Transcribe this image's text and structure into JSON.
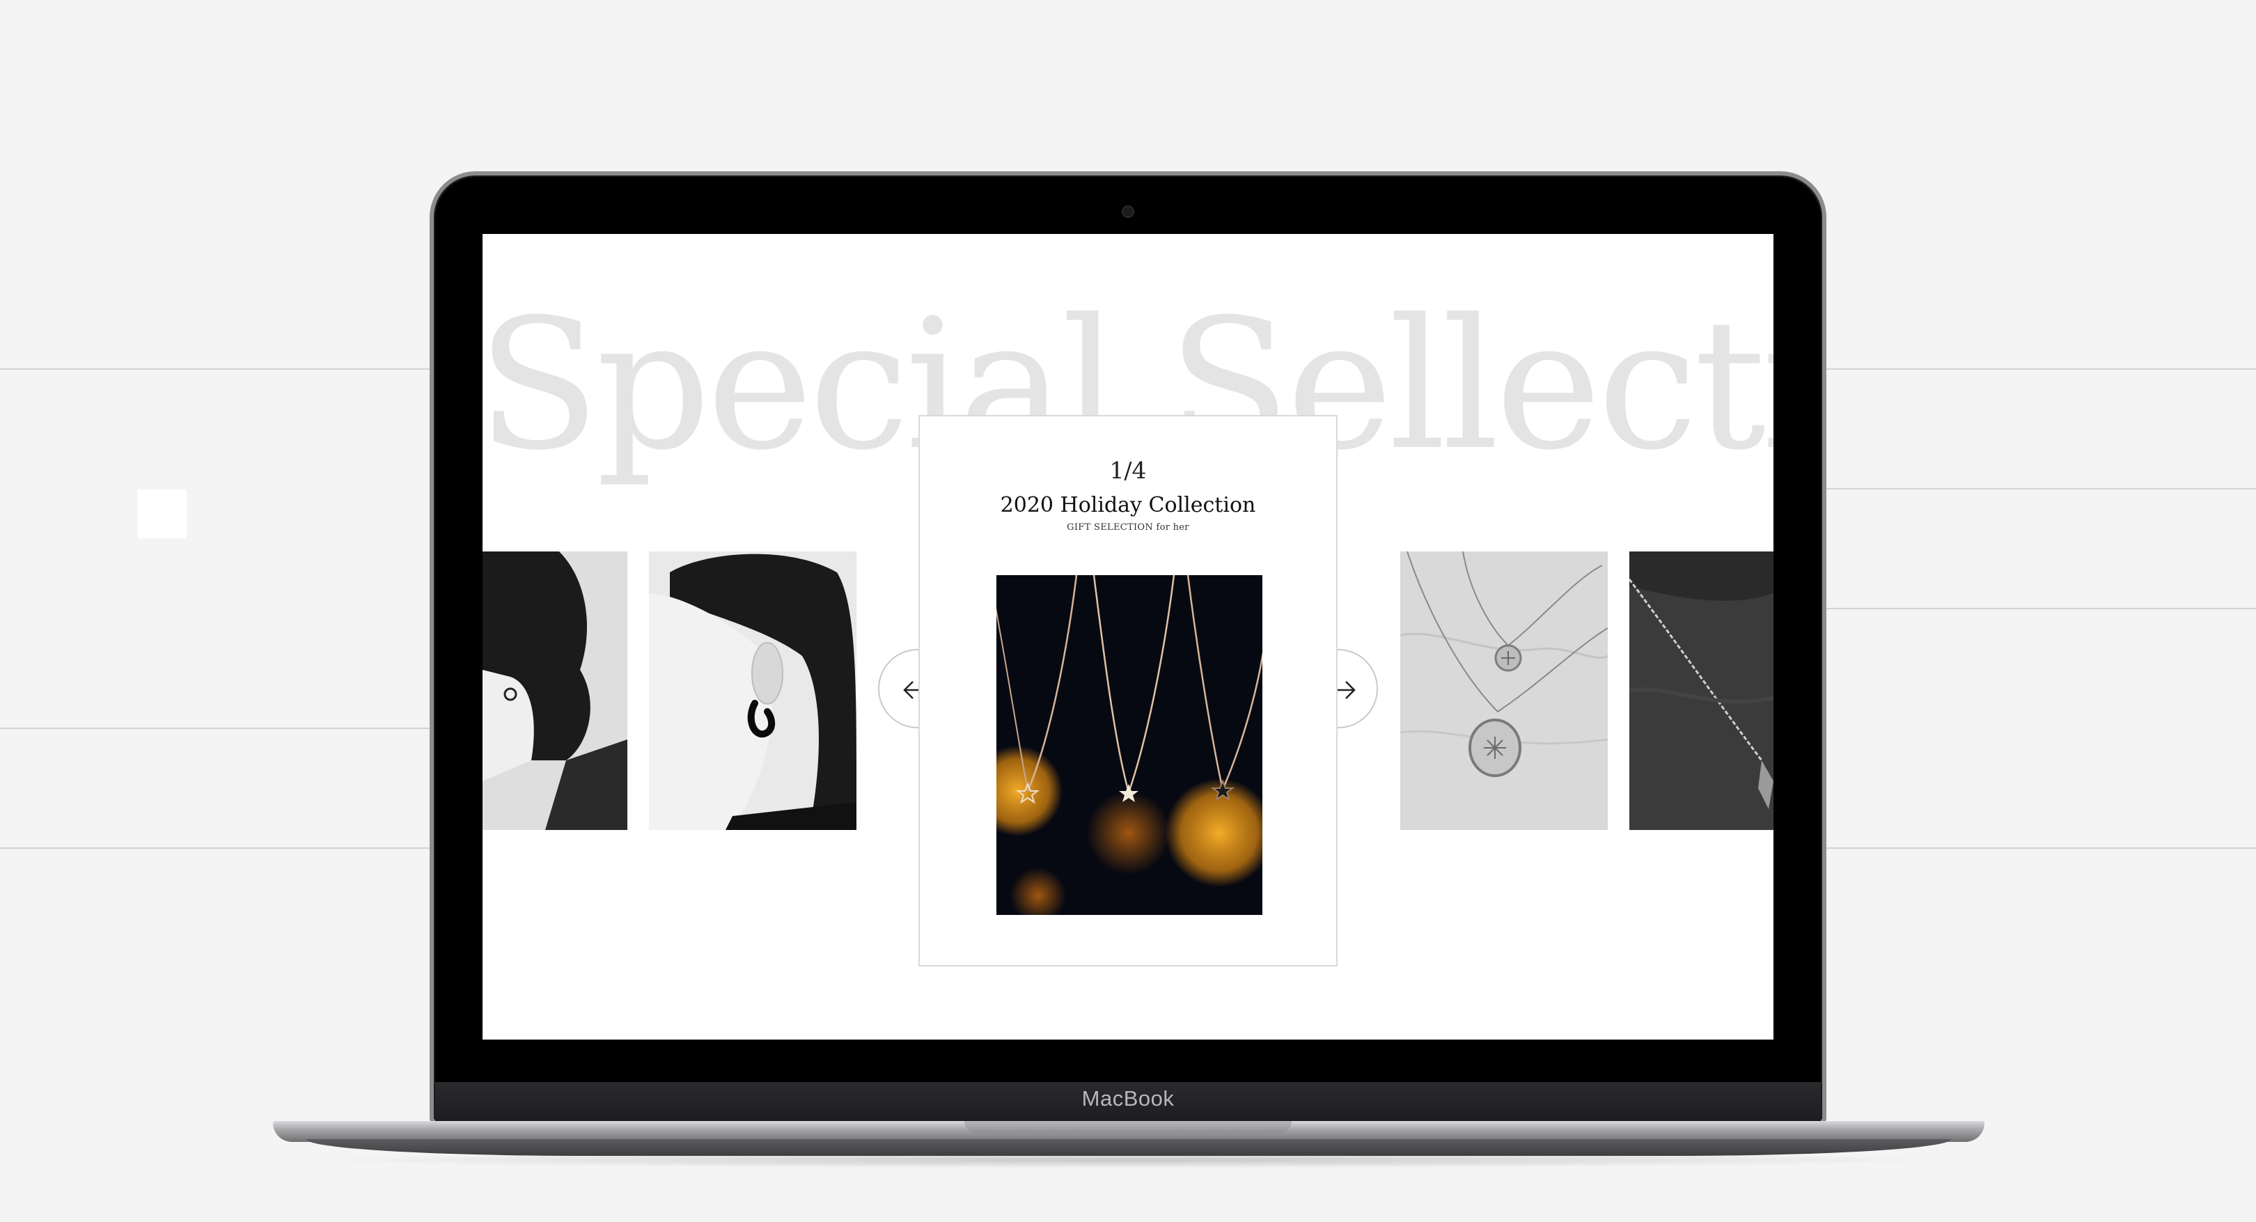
{
  "colors": {
    "background": "#f4f4f4",
    "screen": "#ffffff",
    "hero_text": "#e4e4e4",
    "bezel": "#000000",
    "card_border": "#d9d9d9"
  },
  "laptop": {
    "brand_label": "MacBook"
  },
  "hero": {
    "title": "Special Sellection"
  },
  "slider": {
    "counter": "1/4",
    "title": "2020 Holiday Collection",
    "subtitle": "GIFT SELECTION for her",
    "prev_icon": "arrow-left-icon",
    "next_icon": "arrow-right-icon",
    "slides": [
      {
        "name": "earring-side-profile-photo"
      },
      {
        "name": "black-earring-portrait-photo"
      },
      {
        "name": "star-necklaces-photo"
      },
      {
        "name": "pendant-necklaces-photo"
      },
      {
        "name": "chain-necklace-photo"
      }
    ]
  }
}
